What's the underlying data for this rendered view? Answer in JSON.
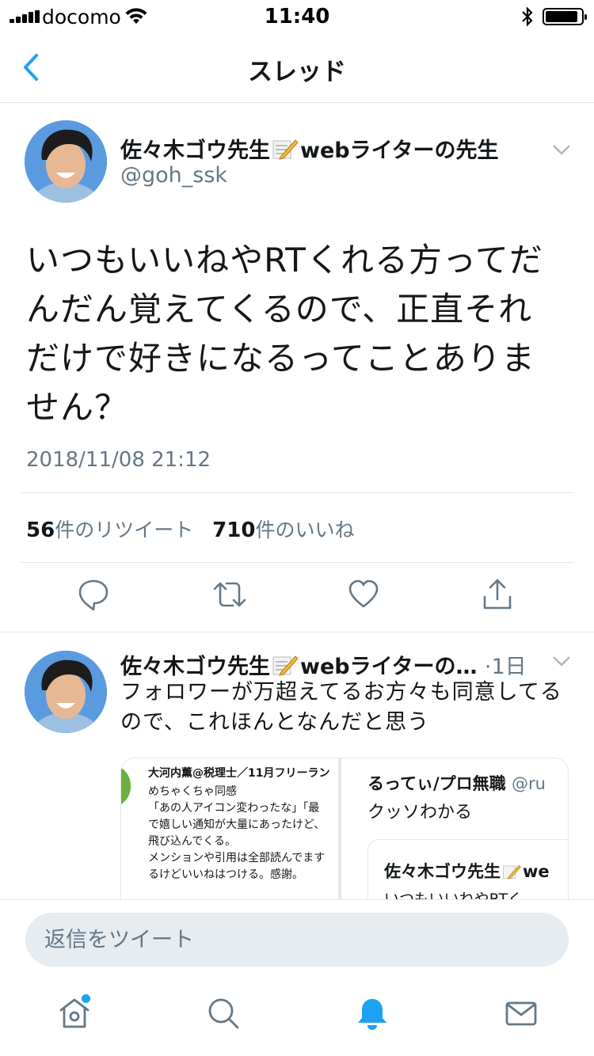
{
  "status_bar": {
    "carrier": "docomo",
    "time": "11:40"
  },
  "header": {
    "title": "スレッド"
  },
  "main_tweet": {
    "author_name_part1": "佐々木ゴウ先生",
    "author_name_part2": "webライターの先生",
    "author_handle": "@goh_ssk",
    "text": "いつもいいねやRTくれる方ってだんだん覚えてくるので、正直それだけで好きになるってことありません？",
    "timestamp": "2018/11/08 21:12",
    "retweets_count": "56",
    "retweets_label": "件のリツイート",
    "likes_count": "710",
    "likes_label": "件のいいね"
  },
  "reply_tweet": {
    "author_name_part1": "佐々木ゴウ先生",
    "author_name_part2": "webライターの…",
    "time_ago": "·1日",
    "text": "フォロワーが万超えてるお方々も同意してるので、これほんとなんだと思う",
    "media_left": {
      "name": "大河内薫@税理士／11月フリーラン",
      "body": "めちゃくちゃ同感\n「あの人アイコン変わったな」「最\nで嬉しい通知が大量にあったけど、\n飛び込んでくる。\nメンションや引用は全部読んでます\nるけどいいねはつける。感謝。"
    },
    "media_right": {
      "name": "るってぃ/プロ無職",
      "handle": "@ru",
      "body": "クッソわかる",
      "quote_name": "佐々木ゴウ先生",
      "quote_name_suffix": "we",
      "quote_text": "いつもいいねやRTく"
    }
  },
  "composer": {
    "placeholder": "返信をツイート"
  },
  "tab_bar": {
    "items": [
      "home-icon",
      "search-icon",
      "notifications-icon",
      "messages-icon"
    ],
    "active": "notifications-icon",
    "home_badge": true
  },
  "colors": {
    "accent": "#1da1f2",
    "secondary_text": "#657786",
    "divider": "#e1e8ed",
    "input_bg": "#e6ecf0"
  }
}
